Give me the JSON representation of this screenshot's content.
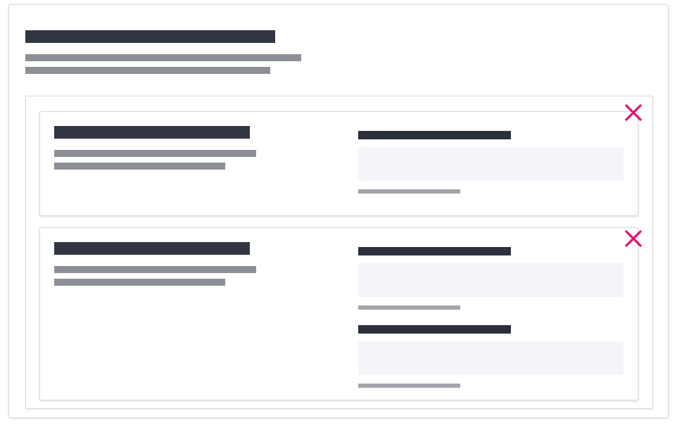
{
  "theme": {
    "background": "#ffffff",
    "text_dark": "#323642",
    "text_muted": "#8d8f96",
    "input_bg": "#f4f5f9",
    "border": "#d8dae3",
    "remove_accent": "#e0106e"
  },
  "header": {
    "title_redacted": true,
    "description_lines": 2
  },
  "items": [
    {
      "remove_icon": "close-icon",
      "title_redacted": true,
      "description_lines": 2,
      "fields": [
        {
          "label_redacted": true,
          "value": "",
          "hint_redacted": true
        }
      ]
    },
    {
      "remove_icon": "close-icon",
      "title_redacted": true,
      "description_lines": 2,
      "fields": [
        {
          "label_redacted": true,
          "value": "",
          "hint_redacted": true
        },
        {
          "label_redacted": true,
          "value": "",
          "hint_redacted": true
        }
      ]
    }
  ]
}
